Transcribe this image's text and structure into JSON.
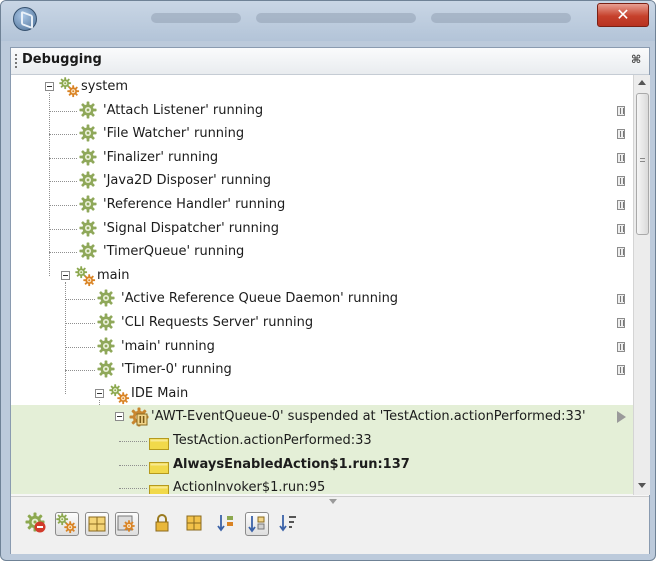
{
  "window": {
    "title": ""
  },
  "panel": {
    "title": "Debugging",
    "close_glyph": "⌘"
  },
  "tree": {
    "rows": [
      {
        "label": "system",
        "icon": "thread-group-icon",
        "kind": "group"
      },
      {
        "label": "'Attach Listener' running",
        "icon": "gear-icon",
        "kind": "thread",
        "action": "pause"
      },
      {
        "label": "'File Watcher' running",
        "icon": "gear-icon",
        "kind": "thread",
        "action": "pause"
      },
      {
        "label": "'Finalizer' running",
        "icon": "gear-icon",
        "kind": "thread",
        "action": "pause"
      },
      {
        "label": "'Java2D Disposer' running",
        "icon": "gear-icon",
        "kind": "thread",
        "action": "pause"
      },
      {
        "label": "'Reference Handler' running",
        "icon": "gear-icon",
        "kind": "thread",
        "action": "pause"
      },
      {
        "label": "'Signal Dispatcher' running",
        "icon": "gear-icon",
        "kind": "thread",
        "action": "pause"
      },
      {
        "label": "'TimerQueue' running",
        "icon": "gear-icon",
        "kind": "thread",
        "action": "pause"
      },
      {
        "label": "main",
        "icon": "thread-group-icon",
        "kind": "group"
      },
      {
        "label": "'Active Reference Queue Daemon' running",
        "icon": "gear-icon",
        "kind": "thread",
        "action": "pause"
      },
      {
        "label": "'CLI Requests Server' running",
        "icon": "gear-icon",
        "kind": "thread",
        "action": "pause"
      },
      {
        "label": "'main' running",
        "icon": "gear-icon",
        "kind": "thread",
        "action": "pause"
      },
      {
        "label": "'Timer-0' running",
        "icon": "gear-icon",
        "kind": "thread",
        "action": "pause"
      },
      {
        "label": "IDE Main",
        "icon": "thread-group-icon",
        "kind": "group"
      },
      {
        "label": "'AWT-EventQueue-0' suspended at 'TestAction.actionPerformed:33'",
        "icon": "suspended-thread-icon",
        "kind": "thread",
        "action": "resume"
      },
      {
        "label": "TestAction.actionPerformed:33",
        "icon": "call-stack-frame-icon",
        "kind": "frame"
      },
      {
        "label": "AlwaysEnabledAction$1.run:137",
        "icon": "call-stack-frame-icon",
        "kind": "frame",
        "bold": true
      },
      {
        "label": "ActionInvoker$1.run:95",
        "icon": "call-stack-frame-icon",
        "kind": "frame"
      }
    ]
  },
  "toolbar": {
    "buttons": [
      {
        "icon": "stop-thread-icon",
        "toggled": false
      },
      {
        "icon": "show-thread-groups-icon",
        "toggled": true
      },
      {
        "icon": "show-suspend-table-icon",
        "toggled": true
      },
      {
        "icon": "show-system-threads-icon",
        "toggled": true
      },
      {
        "icon": "lock-icon",
        "toggled": false
      },
      {
        "icon": "monitors-icon",
        "toggled": false
      },
      {
        "icon": "sort-alphabetic-icon",
        "toggled": false
      },
      {
        "icon": "sort-suspend-icon",
        "toggled": true
      },
      {
        "icon": "sort-natural-icon",
        "toggled": false
      }
    ]
  },
  "colors": {
    "highlight_row": "#e4efd7",
    "frame_icon": "#f1d94a",
    "close_button": "#c6412c"
  }
}
